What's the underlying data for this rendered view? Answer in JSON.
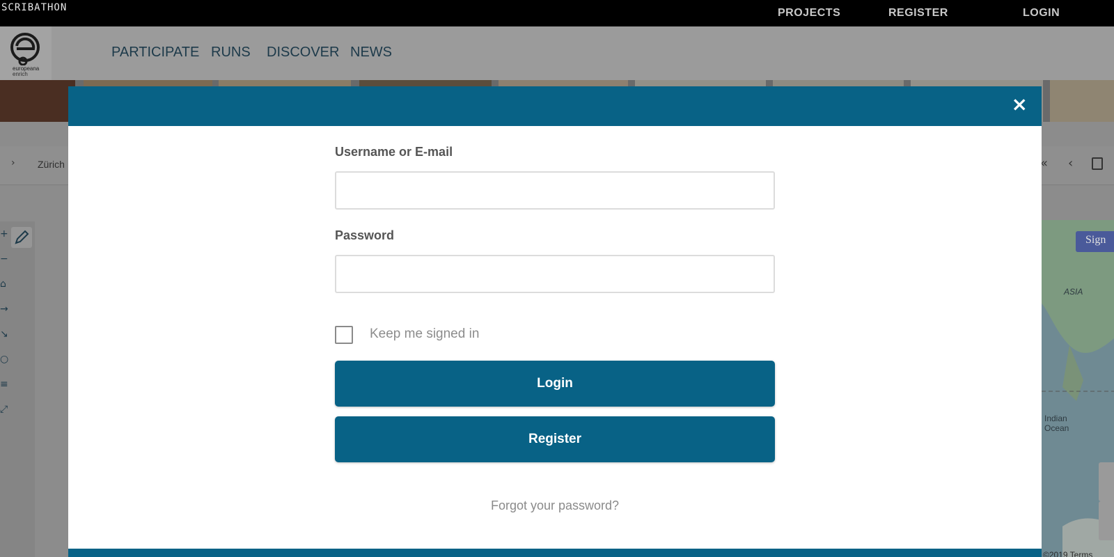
{
  "topbar": {
    "brand": "SCRIBATHON",
    "links": [
      "PROJECTS",
      "REGISTER",
      "LOGIN"
    ]
  },
  "logo": {
    "line1": "europeana",
    "line2": "enrich"
  },
  "nav": [
    "PARTICIPATE",
    "RUNS",
    "DISCOVER",
    "NEWS"
  ],
  "breadcrumb": {
    "arrow": "›",
    "text": "Zürich"
  },
  "page_controls": {
    "first": "«",
    "prev": "‹"
  },
  "map": {
    "sign_in_label": "Sign",
    "labels": {
      "asia": "ASIA",
      "indian1": "Indian",
      "indian2": "Ocean"
    },
    "copyright": "©2019   Terms"
  },
  "modal": {
    "close": "×",
    "username_label": "Username or E-mail",
    "username_value": "",
    "password_label": "Password",
    "password_value": "",
    "remember_label": "Keep me signed in",
    "remember_checked": false,
    "login_button": "Login",
    "register_button": "Register",
    "forgot_link": "Forgot your password?"
  },
  "colors": {
    "primary": "#086286",
    "overlay": "#8c8c8c"
  }
}
